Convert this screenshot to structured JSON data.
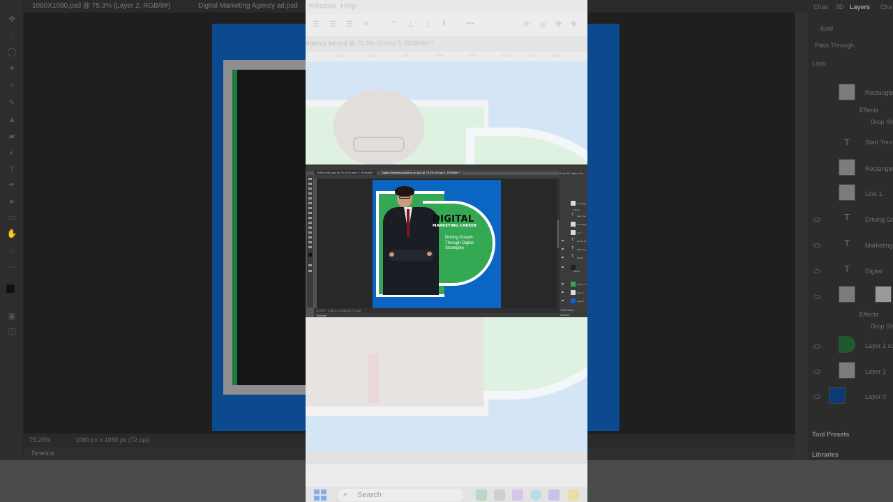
{
  "background_window": {
    "tab_left": "1080X1080.psd @ 75.3% (Layer 2, RGB/8#)",
    "tab_right": "Digital Marketing Agency ad.psd",
    "zoom": "75.29%",
    "doc_size": "1080 px x 1080 px (72 ppi)",
    "timeline_label": "Timeline",
    "right_panel": {
      "tabs": [
        "Chan",
        "3D",
        "Layers",
        "Cha"
      ],
      "kind_filter": "Kind",
      "blend_mode": "Pass Through",
      "lock_label": "Lock:",
      "layers": [
        "Rectangle",
        "Effects",
        "Drop Sh",
        "Start Your",
        "Rectangle",
        "Line 1",
        "Driving Gr",
        "Marketing",
        "Digital",
        "Effects",
        "Drop Sh",
        "Layer 1 co",
        "Layer 1",
        "Layer 0"
      ],
      "bottom_label": "Tool Presets",
      "libraries_label": "Libraries"
    }
  },
  "strip": {
    "menu": [
      "Window",
      "Help"
    ],
    "tab_title": "Agency ad.psd @ 75.3% (Group 1, RGB/8#) *",
    "ruler_ticks": [
      "100",
      "200",
      "300",
      "400",
      "500",
      "600",
      "700",
      "800"
    ],
    "taskbar_search": "Search"
  },
  "inset": {
    "tabs": [
      {
        "label": "1080X1080.psd @ 75.3% (Layer 2, RGB/8#) *",
        "active": false
      },
      {
        "label": "Digital Marketing Agency ad.psd @ 75.3% (Group 1, RGB/8#) *",
        "active": true
      }
    ],
    "status_zoom": "75.29%",
    "status_doc": "1080 px x 1080 px (72 ppi)",
    "timeline": "Timeline",
    "panel_tabs": "Chan  3D  Layers  Cha",
    "layers": [
      {
        "name": "Rectangle",
        "type": "thumb"
      },
      {
        "name": "Effects",
        "type": "fx"
      },
      {
        "name": "Start Your",
        "type": "text"
      },
      {
        "name": "Rectangle",
        "type": "thumb"
      },
      {
        "name": "Line 1",
        "type": "thumb"
      },
      {
        "name": "Driving Gr",
        "type": "text"
      },
      {
        "name": "Marketing",
        "type": "text"
      },
      {
        "name": "Digital",
        "type": "text"
      },
      {
        "name": "Effects",
        "type": "fx"
      },
      {
        "name": "Layer 1 co",
        "type": "thumb"
      },
      {
        "name": "Layer 1",
        "type": "thumb"
      },
      {
        "name": "Layer 0",
        "type": "thumb"
      }
    ],
    "panel_bottom": "Tool Presets",
    "panel_libraries": "Libraries"
  },
  "ad": {
    "title": "DIGITAL",
    "subtitle": "MARKETING CAREER",
    "tagline": [
      "Driving Growth",
      "Through Digital",
      "Strategies"
    ],
    "colors": {
      "background": "#0b66c3",
      "green": "#34a853",
      "frame": "#ffffff"
    }
  }
}
